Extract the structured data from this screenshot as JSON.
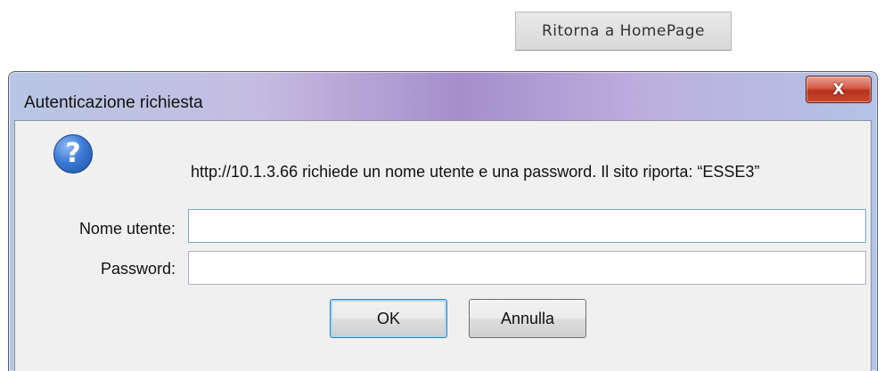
{
  "page": {
    "home_button_label": "Ritorna a HomePage"
  },
  "dialog": {
    "title": "Autenticazione richiesta",
    "close_label": "X",
    "icon": "help-question-icon",
    "message": "http://10.1.3.66 richiede un nome utente e una password. Il sito riporta: “ESSE3”",
    "username_label": "Nome utente:",
    "username_value": "",
    "password_label": "Password:",
    "password_value": "",
    "ok_label": "OK",
    "cancel_label": "Annulla"
  }
}
